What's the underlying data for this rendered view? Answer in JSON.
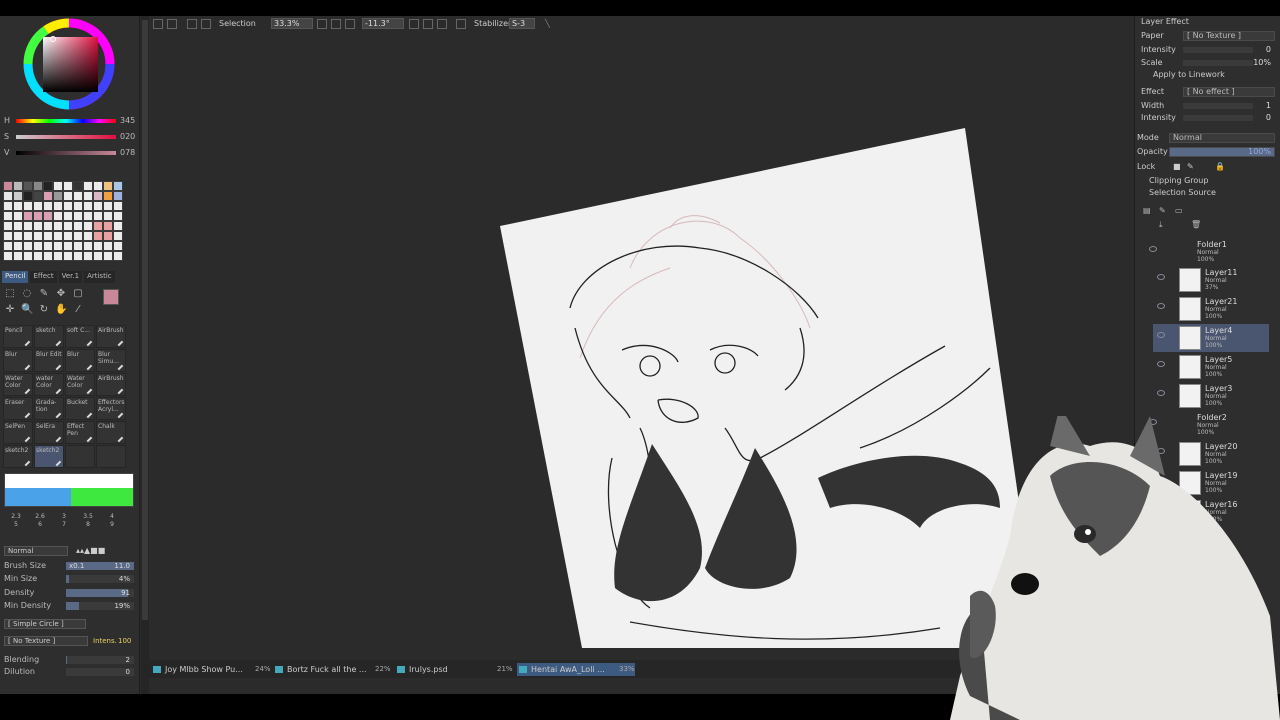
{
  "color": {
    "h_label": "H",
    "h_value": "345",
    "s_label": "S",
    "s_value": "020",
    "v_label": "V",
    "v_value": "078"
  },
  "tool_tabs": [
    "Pencil",
    "Effect",
    "Ver.1",
    "Artistic"
  ],
  "brushes": [
    [
      "Pencil",
      "sketch",
      "soft C...",
      "AirBrush"
    ],
    [
      "Blur",
      "Blur Edit",
      "Blur",
      "Blur Simu..."
    ],
    [
      "Water Color",
      "water Color",
      "Water Color",
      "AirBrush"
    ],
    [
      "Eraser",
      "Grada- tion",
      "Bucket",
      "Effectors Acryl..."
    ],
    [
      "SelPen",
      "SelEra",
      "Effect Pen",
      "Chalk"
    ],
    [
      "sketch2",
      "sketch2",
      "",
      ""
    ]
  ],
  "brush_sizes_row1": [
    "2.3",
    "2.6",
    "3",
    "3.5",
    "4"
  ],
  "brush_sizes_row2": [
    "5",
    "6",
    "7",
    "8",
    "9"
  ],
  "brush_settings": {
    "blend_mode": "Normal",
    "brush_size_label": "Brush Size",
    "brush_size_mult": "x0.1",
    "brush_size_value": "11.0",
    "min_size_label": "Min Size",
    "min_size_value": "4%",
    "density_label": "Density",
    "density_value": "91",
    "min_density_label": "Min Density",
    "min_density_value": "19%",
    "shape": "[ Simple Circle ]",
    "texture": "[ No Texture ]",
    "intens_label": "Intens.",
    "intens_value": "100",
    "blending_label": "Blending",
    "blending_value": "2",
    "dilution_label": "Dilution",
    "dilution_value": "0"
  },
  "toolbar": {
    "selection_label": "Selection",
    "zoom": "33.3%",
    "rotation": "-11.3°",
    "stabilizer_label": "Stabilizer",
    "stabilizer_value": "S-3"
  },
  "documents": [
    {
      "name": "Joy Mlbb Show Pu...",
      "zoom": "24%",
      "active": false
    },
    {
      "name": "Bortz Fuck all the ...",
      "zoom": "22%",
      "active": false
    },
    {
      "name": "Irulys.psd",
      "zoom": "21%",
      "active": false
    },
    {
      "name": "Hentai AwA_Loli ...",
      "zoom": "33%",
      "active": true
    }
  ],
  "layer_effect": {
    "title": "Layer Effect",
    "paper_label": "Paper",
    "paper_value": "[ No Texture ]",
    "intensity_label": "Intensity",
    "intensity_value": "0",
    "scale_label": "Scale",
    "scale_value": "10%",
    "apply_linework": "Apply to Linework",
    "effect_label": "Effect",
    "effect_value": "[ No effect ]",
    "width_label": "Width",
    "width_value": "1",
    "intensity2_label": "Intensity",
    "intensity2_value": "0",
    "mode_label": "Mode",
    "mode_value": "Normal",
    "opacity_label": "Opacity",
    "opacity_value": "100%",
    "lock_label": "Lock",
    "clipping_group": "Clipping Group",
    "selection_source": "Selection Source"
  },
  "layers": [
    {
      "name": "Folder1",
      "mode": "Normal",
      "opacity": "100%"
    },
    {
      "name": "Layer11",
      "mode": "Normal",
      "opacity": "37%"
    },
    {
      "name": "Layer21",
      "mode": "Normal",
      "opacity": "100%"
    },
    {
      "name": "Layer4",
      "mode": "Normal",
      "opacity": "100%"
    },
    {
      "name": "Layer5",
      "mode": "Normal",
      "opacity": "100%"
    },
    {
      "name": "Layer3",
      "mode": "Normal",
      "opacity": "100%"
    },
    {
      "name": "Folder2",
      "mode": "Normal",
      "opacity": "100%"
    },
    {
      "name": "Layer20",
      "mode": "Normal",
      "opacity": "100%"
    },
    {
      "name": "Layer19",
      "mode": "Normal",
      "opacity": "100%"
    },
    {
      "name": "Layer16",
      "mode": "Normal",
      "opacity": "100%"
    }
  ],
  "colors": {
    "accent": "#3d5a80",
    "primary_color": "#c8889a",
    "canvas_bg": "#2b2b2b"
  }
}
